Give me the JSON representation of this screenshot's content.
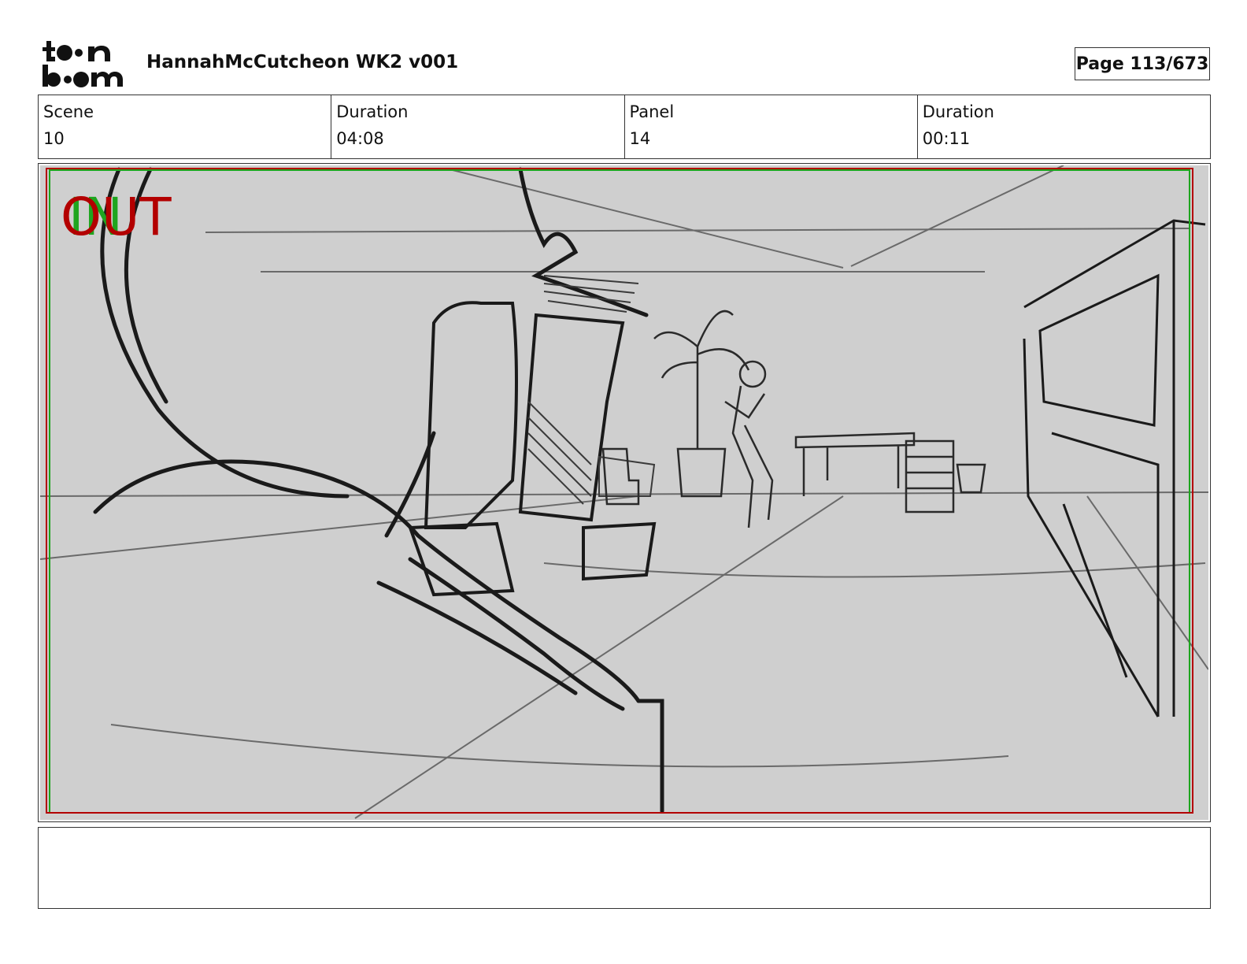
{
  "header": {
    "logo_text_top": "toon",
    "logo_text_bottom": "boom",
    "title": "HannahMcCutcheon WK2 v001",
    "page": "Page 113/673"
  },
  "info": {
    "scene_label": "Scene",
    "scene_value": "10",
    "scene_duration_label": "Duration",
    "scene_duration_value": "04:08",
    "panel_label": "Panel",
    "panel_value": "14",
    "panel_duration_label": "Duration",
    "panel_duration_value": "00:11"
  },
  "panel": {
    "in_marker": "IN",
    "out_marker": "OUT",
    "colors": {
      "background": "#cfcfcf",
      "in_frame": "#1fa51f",
      "out_frame": "#b30000",
      "sketch": "#1a1a1a"
    }
  },
  "caption": {
    "text": ""
  }
}
